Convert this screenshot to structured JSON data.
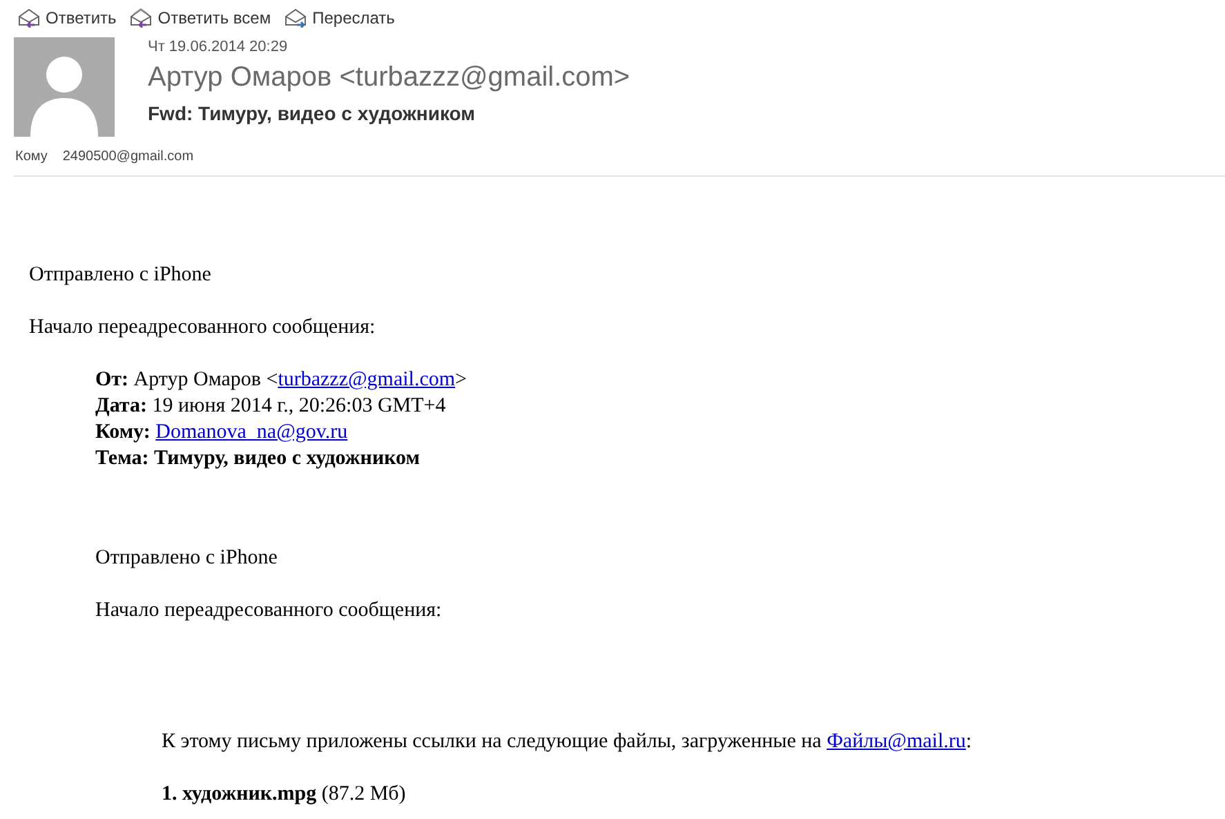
{
  "toolbar": [
    {
      "label": "Ответить",
      "kind": "reply"
    },
    {
      "label": "Ответить всем",
      "kind": "reply-all"
    },
    {
      "label": "Переслать",
      "kind": "forward"
    }
  ],
  "message": {
    "date": "Чт 19.06.2014 20:29",
    "sender": "Артур Омаров <turbazzz@gmail.com>",
    "subject": "Fwd: Тимуру, видео с художником",
    "to_label": "Кому",
    "to": "2490500@gmail.com"
  },
  "body": {
    "sent_from": "Отправлено с iPhone",
    "forward_intro": "Начало переадресованного сообщения:",
    "forward_header": [
      {
        "label": "От:",
        "before": "Артур Омаров <",
        "link": "turbazzz@gmail.com",
        "after": ">",
        "bold": false
      },
      {
        "label": "Дата:",
        "before": "19 июня 2014 г., 20:26:03 GMT+4",
        "bold": false
      },
      {
        "label": "Кому:",
        "link": "Domanova_na@gov.ru",
        "bold": false
      },
      {
        "label": "Тема:",
        "before": "Тимуру, видео с художником",
        "bold": true
      }
    ],
    "sent_from_2": "Отправлено с iPhone",
    "forward_intro_2": "Начало переадресованного сообщения:",
    "files_intro": {
      "before": "К этому письму приложены ссылки на следующие файлы, загруженные на ",
      "link": "Файлы@mail.ru",
      "after": ":"
    },
    "files": [
      {
        "name": "1. художник.mpg",
        "size": "(87.2 Мб)"
      }
    ]
  }
}
